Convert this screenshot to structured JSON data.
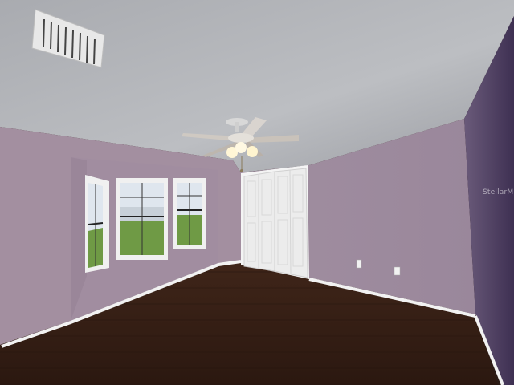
{
  "watermark": {
    "text": "StellarMLS"
  },
  "colors": {
    "ceiling": "#b7b9bd",
    "wall_left": "#a38fa0",
    "wall_back": "#9e8a9a",
    "wall_right_dark": "#5a4a6a",
    "floor": "#3a2218",
    "trim": "#f2f2f2",
    "window_outside_sky": "#dfe6ee",
    "window_outside_foliage": "#6f9a45"
  }
}
